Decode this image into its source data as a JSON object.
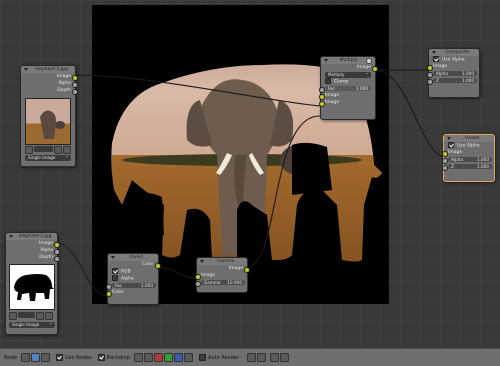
{
  "nodes": {
    "image1": {
      "title": "elephant-2.jpg",
      "outputs": [
        "Image",
        "Alpha",
        "Depth"
      ],
      "source": "Single Image"
    },
    "image2": {
      "title": "elephant-2.jpg",
      "outputs": [
        "Image",
        "Alpha",
        "Depth"
      ],
      "source": "Single Image"
    },
    "mix": {
      "title": "Multiply",
      "output": "Image",
      "blend_mode": "Multiply",
      "clamp_label": "Clamp",
      "fac_label": "Fac",
      "fac_value": "1.000",
      "inputs": [
        "Image",
        "Image"
      ]
    },
    "invert": {
      "title": "Invert",
      "output": "Color",
      "rgb_label": "RGB",
      "alpha_label": "Alpha",
      "fac_label": "Fac",
      "fac_value": "1.000",
      "color_in": "Color"
    },
    "gamma": {
      "title": "Gamma",
      "output": "Image",
      "input": "Image",
      "gamma_label": "Gamma",
      "gamma_value": "10.000"
    },
    "composite": {
      "title": "Composite",
      "use_alpha": "Use Alpha",
      "image": "Image",
      "alpha_label": "Alpha",
      "alpha_value": "1.000",
      "z_label": "Z",
      "z_value": "1.000"
    },
    "viewer": {
      "title": "Viewer",
      "use_alpha": "Use Alpha",
      "image": "Image",
      "alpha_label": "Alpha",
      "alpha_value": "1.000",
      "z_label": "Z",
      "z_value": "1.000"
    }
  },
  "toolbar": {
    "node_label": "Node",
    "use_nodes": "Use Nodes",
    "backdrop": "Backdrop",
    "auto_render": "Auto Render"
  },
  "colors": {
    "socket_color": "#c7c729",
    "socket_gray": "#a1a1a1",
    "socket_blue": "#6363c7",
    "active_border": "#e7a55a"
  }
}
